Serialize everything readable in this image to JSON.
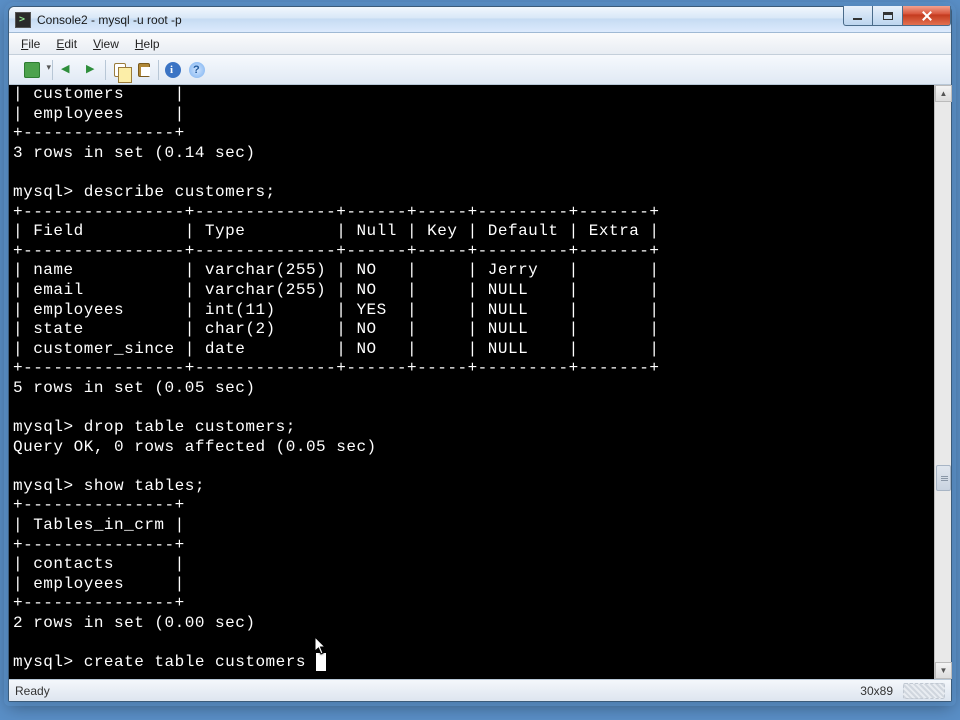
{
  "window": {
    "title": "Console2 - mysql  -u root -p"
  },
  "menu": {
    "file": "File",
    "edit": "Edit",
    "view": "View",
    "help": "Help"
  },
  "statusbar": {
    "status": "Ready",
    "dims": "30x89"
  },
  "terminal": {
    "lines": [
      "| customers     |",
      "| employees     |",
      "+---------------+",
      "3 rows in set (0.14 sec)",
      "",
      "mysql> describe customers;",
      "+----------------+--------------+------+-----+---------+-------+",
      "| Field          | Type         | Null | Key | Default | Extra |",
      "+----------------+--------------+------+-----+---------+-------+",
      "| name           | varchar(255) | NO   |     | Jerry   |       |",
      "| email          | varchar(255) | NO   |     | NULL    |       |",
      "| employees      | int(11)      | YES  |     | NULL    |       |",
      "| state          | char(2)      | NO   |     | NULL    |       |",
      "| customer_since | date         | NO   |     | NULL    |       |",
      "+----------------+--------------+------+-----+---------+-------+",
      "5 rows in set (0.05 sec)",
      "",
      "mysql> drop table customers;",
      "Query OK, 0 rows affected (0.05 sec)",
      "",
      "mysql> show tables;",
      "+---------------+",
      "| Tables_in_crm |",
      "+---------------+",
      "| contacts      |",
      "| employees     |",
      "+---------------+",
      "2 rows in set (0.00 sec)",
      "",
      "mysql> create table customers "
    ]
  }
}
